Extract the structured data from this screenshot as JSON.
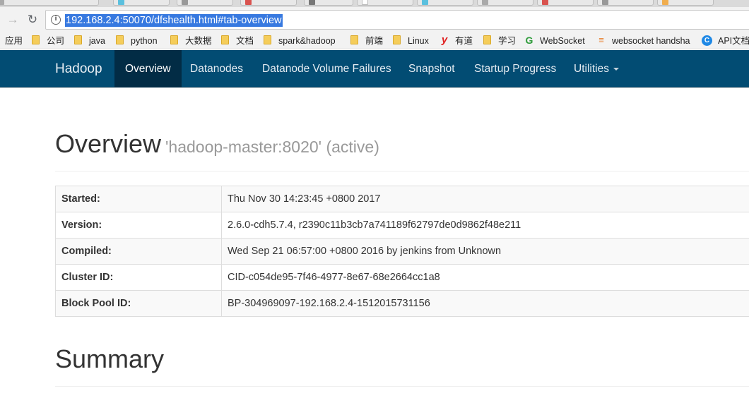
{
  "browser": {
    "url": "192.168.2.4:50070/dfshealth.html#tab-overview",
    "bookmarks": [
      {
        "label": "应用",
        "icon": "apps-icon"
      },
      {
        "label": "公司",
        "icon": "folder-icon"
      },
      {
        "label": "java",
        "icon": "folder-icon"
      },
      {
        "label": "python",
        "icon": "folder-icon"
      },
      {
        "label": "大数据",
        "icon": "folder-icon"
      },
      {
        "label": "文档",
        "icon": "folder-icon"
      },
      {
        "label": "spark&hadoop",
        "icon": "folder-icon"
      },
      {
        "label": "前端",
        "icon": "folder-icon"
      },
      {
        "label": "Linux",
        "icon": "folder-icon"
      },
      {
        "label": "有道",
        "icon": "youdao-icon"
      },
      {
        "label": "学习",
        "icon": "folder-icon"
      },
      {
        "label": "WebSocket",
        "icon": "websocket-icon"
      },
      {
        "label": "websocket handsha",
        "icon": "stackoverflow-icon"
      },
      {
        "label": "API文档",
        "icon": "api-docs-icon"
      }
    ]
  },
  "navbar": {
    "brand": "Hadoop",
    "items": [
      {
        "label": "Overview",
        "active": true
      },
      {
        "label": "Datanodes"
      },
      {
        "label": "Datanode Volume Failures"
      },
      {
        "label": "Snapshot"
      },
      {
        "label": "Startup Progress"
      },
      {
        "label": "Utilities",
        "dropdown": true
      }
    ],
    "colors": {
      "background": "#024c73",
      "active": "#022c45"
    }
  },
  "overview": {
    "title": "Overview",
    "subtitle": "'hadoop-master:8020' (active)",
    "rows": [
      {
        "key": "Started:",
        "value": "Thu Nov 30 14:23:45 +0800 2017"
      },
      {
        "key": "Version:",
        "value": "2.6.0-cdh5.7.4, r2390c11b3cb7a741189f62797de0d9862f48e211"
      },
      {
        "key": "Compiled:",
        "value": "Wed Sep 21 06:57:00 +0800 2016 by jenkins from Unknown"
      },
      {
        "key": "Cluster ID:",
        "value": "CID-c054de95-7f46-4977-8e67-68e2664cc1a8"
      },
      {
        "key": "Block Pool ID:",
        "value": "BP-304969097-192.168.2.4-1512015731156"
      }
    ]
  },
  "summary": {
    "title": "Summary"
  }
}
